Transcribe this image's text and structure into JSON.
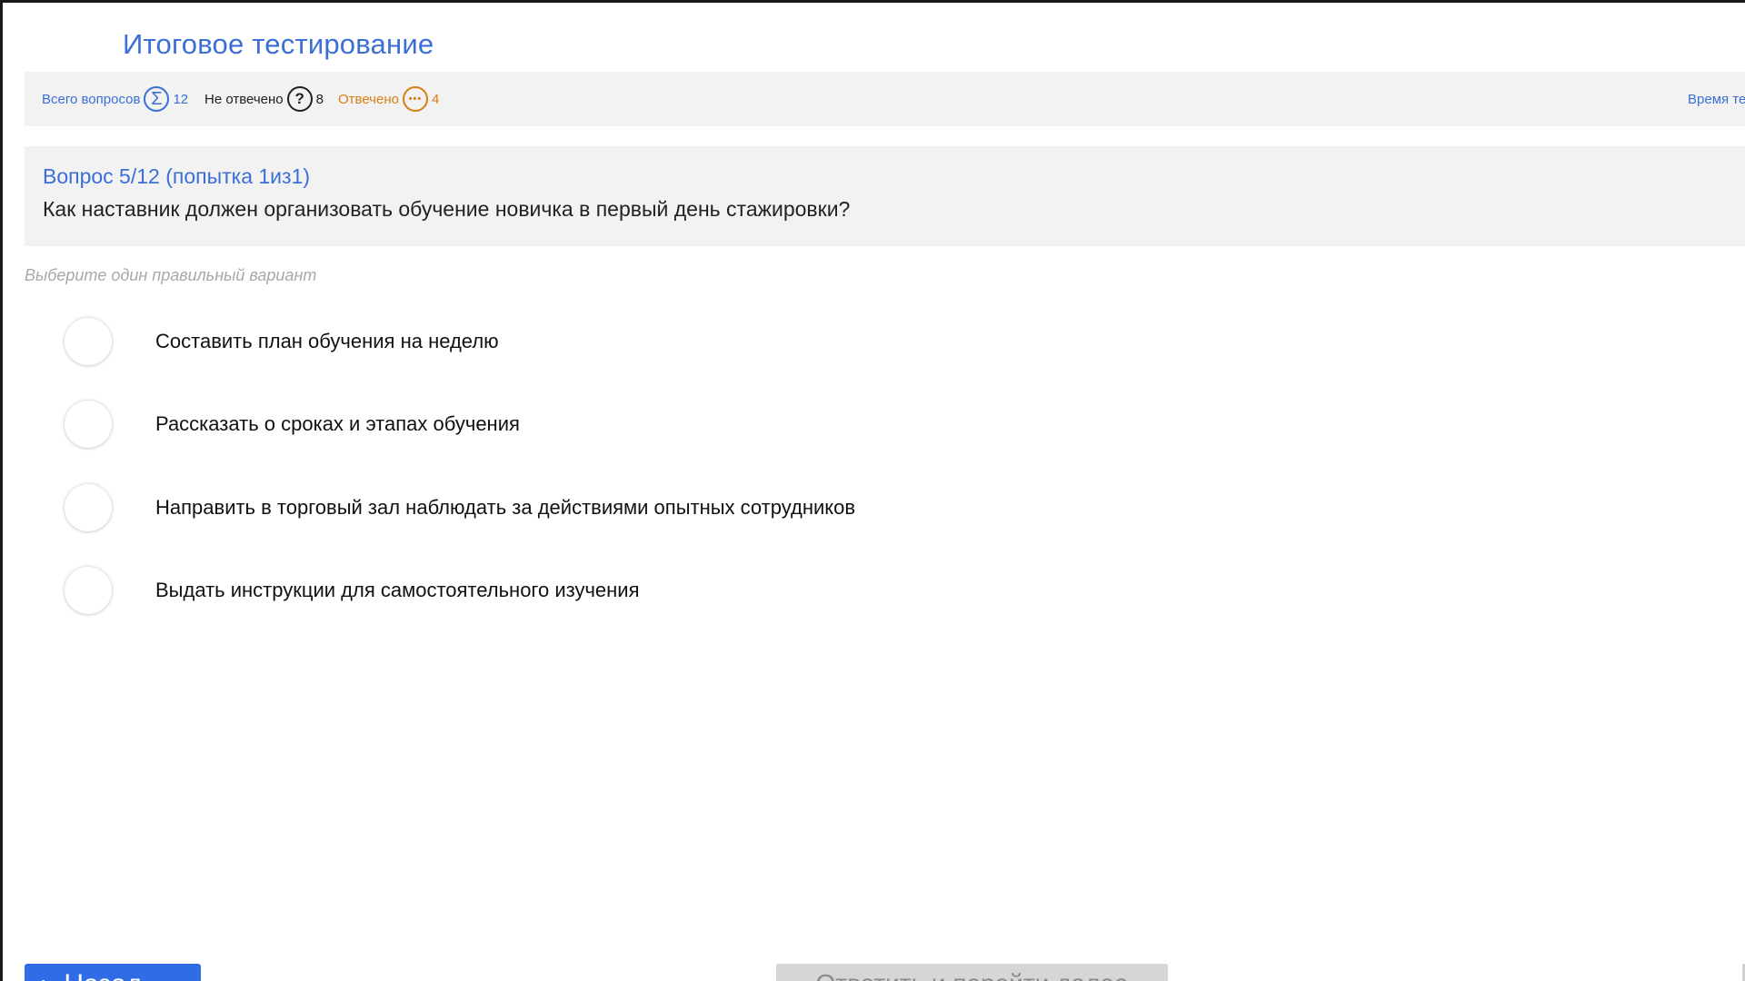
{
  "page": {
    "title": "Итоговое тестирование"
  },
  "stats": {
    "total_label": "Всего вопросов",
    "total_icon": "sigma-icon",
    "total_icon_glyph": "Σ",
    "total_count": "12",
    "unanswered_label": "Не отвечено",
    "unanswered_icon": "question-mark-icon",
    "unanswered_icon_glyph": "?",
    "unanswered_count": "8",
    "answered_label": "Отвечено",
    "answered_icon": "ellipsis-icon",
    "answered_icon_glyph": "•••",
    "answered_count": "4",
    "timer_label_partial": "Время те"
  },
  "question": {
    "header": "Вопрос 5/12  (попытка 1из1)",
    "text": "Как наставник должен организовать обучение новичка в первый день стажировки?",
    "instruction": "Выберите один правильный вариант",
    "options": [
      {
        "label": "Составить план обучения на неделю",
        "selected": false
      },
      {
        "label": "Рассказать о сроках и этапах обучения",
        "selected": false
      },
      {
        "label": "Направить в торговый зал наблюдать за действиями опытных сотрудников",
        "selected": false
      },
      {
        "label": "Выдать инструкции для самостоятельного изучения",
        "selected": false
      }
    ]
  },
  "footer": {
    "back_icon": "chevron-left-icon",
    "back_icon_glyph": "‹",
    "back_label": "Назад",
    "next_label": "Ответить и перейти далее"
  },
  "colors": {
    "accent_blue": "#3b6fd6",
    "answered_orange": "#d57f14",
    "panel_gray": "#f2f2f2",
    "button_blue": "#2f6de6",
    "button_disabled": "#d6d6d6"
  }
}
